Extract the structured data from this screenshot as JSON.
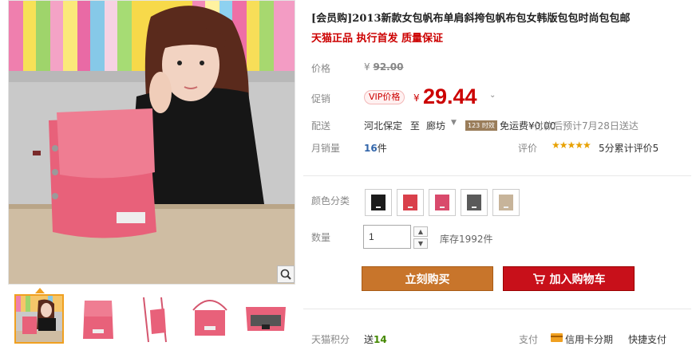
{
  "product": {
    "title": "[会员购]2013新款女包帆布单肩斜挎包帆布包女韩版包包时尚包包邮",
    "subtitle": "天猫正品 执行首发 质量保证"
  },
  "price": {
    "label": "价格",
    "currency": "¥",
    "original": "92.00",
    "promo_label": "促销",
    "vip_tag": "VIP价格",
    "promo_currency": "¥",
    "promo_value": "29.44"
  },
  "shipping": {
    "label": "配送",
    "from": "河北保定",
    "to_prefix": "至",
    "to": "廊坊",
    "time_badge": "123 时效",
    "fee": "免运费¥0.00",
    "eta": "付款后预计7月28日送达"
  },
  "sales": {
    "label": "月销量",
    "count": "16",
    "unit": "件",
    "review_label": "评价",
    "stars": "★★★★★",
    "review_text": "5分累计评价5"
  },
  "options": {
    "color_label": "颜色分类",
    "colors": [
      "#1b1b1b",
      "#d9404b",
      "#d94a6c",
      "#5a5a5a",
      "#c7b49a"
    ],
    "qty_label": "数量",
    "qty_value": "1",
    "stock": "库存1992件"
  },
  "actions": {
    "buy": "立刻购买",
    "cart": "加入购物车"
  },
  "footer": {
    "points_label": "天猫积分",
    "points_prefix": "送",
    "points_value": "14",
    "pay_label": "支付",
    "pay_card": "信用卡分期",
    "pay_fast": "快捷支付"
  },
  "colors": {
    "price_red": "#cc0000",
    "buy_orange": "#c8752b",
    "cart_red": "#c8101a",
    "bag_pink": "#e8617a"
  }
}
